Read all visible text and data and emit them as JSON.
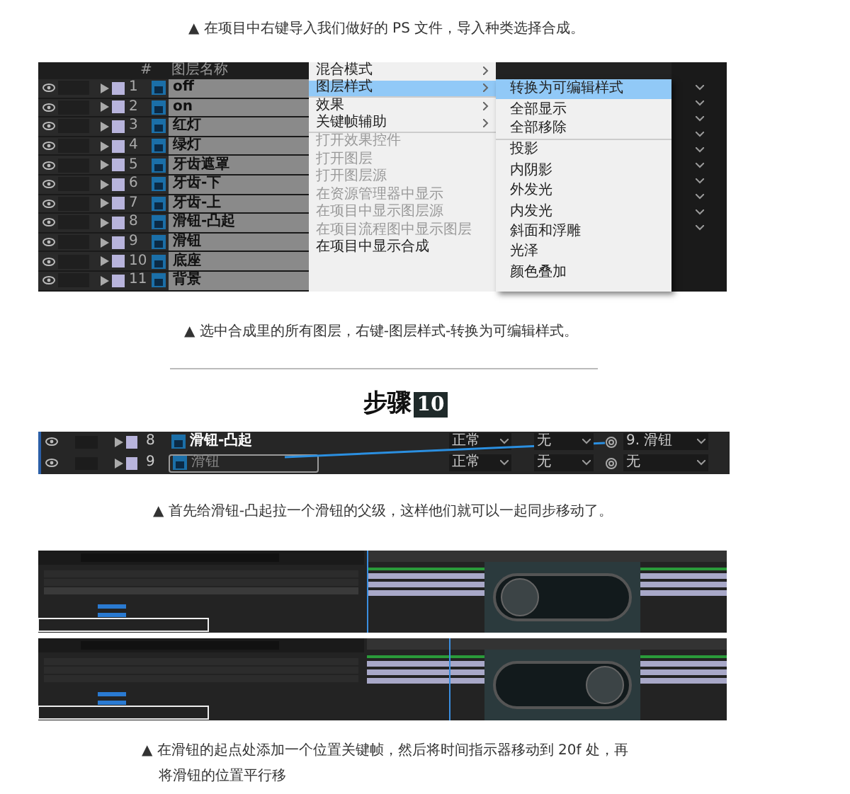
{
  "caption_1": "▲ 在项目中右键导入我们做好的 PS 文件，导入种类选择合成。",
  "screenshot_1": {
    "header": {
      "number": "#",
      "name": "图层名称"
    },
    "layers": [
      {
        "number": "1",
        "name": "off"
      },
      {
        "number": "2",
        "name": "on"
      },
      {
        "number": "3",
        "name": "红灯"
      },
      {
        "number": "4",
        "name": "绿灯"
      },
      {
        "number": "5",
        "name": "牙齿遮罩"
      },
      {
        "number": "6",
        "name": "牙齿-下"
      },
      {
        "number": "7",
        "name": "牙齿-上"
      },
      {
        "number": "8",
        "name": "滑钮-凸起"
      },
      {
        "number": "9",
        "name": "滑钮"
      },
      {
        "number": "10",
        "name": "底座"
      },
      {
        "number": "11",
        "name": "背景"
      }
    ],
    "menu": [
      {
        "label": "混合模式",
        "submenu": true,
        "disabled": false,
        "selected": false,
        "separator_after": false
      },
      {
        "label": "图层样式",
        "submenu": true,
        "disabled": false,
        "selected": true,
        "separator_after": true
      },
      {
        "label": "效果",
        "submenu": true,
        "disabled": false,
        "selected": false,
        "separator_after": false
      },
      {
        "label": "关键帧辅助",
        "submenu": true,
        "disabled": false,
        "selected": false,
        "separator_after": true
      },
      {
        "label": "打开效果控件",
        "submenu": false,
        "disabled": true,
        "selected": false,
        "separator_after": false
      },
      {
        "label": "打开图层",
        "submenu": false,
        "disabled": true,
        "selected": false,
        "separator_after": false
      },
      {
        "label": "打开图层源",
        "submenu": false,
        "disabled": true,
        "selected": false,
        "separator_after": false
      },
      {
        "label": "在资源管理器中显示",
        "submenu": false,
        "disabled": true,
        "selected": false,
        "separator_after": false
      },
      {
        "label": "在项目中显示图层源",
        "submenu": false,
        "disabled": true,
        "selected": false,
        "separator_after": false
      },
      {
        "label": "在项目流程图中显示图层",
        "submenu": false,
        "disabled": true,
        "selected": false,
        "separator_after": false
      },
      {
        "label": "在项目中显示合成",
        "submenu": false,
        "disabled": false,
        "selected": false,
        "separator_after": false
      }
    ],
    "submenu": [
      {
        "label": "转换为可编辑样式",
        "selected": true,
        "separator_after": false
      },
      {
        "label": "全部显示",
        "selected": false,
        "separator_after": false
      },
      {
        "label": "全部移除",
        "selected": false,
        "separator_after": true
      },
      {
        "label": "投影",
        "selected": false,
        "separator_after": false
      },
      {
        "label": "内阴影",
        "selected": false,
        "separator_after": false
      },
      {
        "label": "外发光",
        "selected": false,
        "separator_after": false
      },
      {
        "label": "内发光",
        "selected": false,
        "separator_after": false
      },
      {
        "label": "斜面和浮雕",
        "selected": false,
        "separator_after": false
      },
      {
        "label": "光泽",
        "selected": false,
        "separator_after": false
      },
      {
        "label": "颜色叠加",
        "selected": false,
        "separator_after": false
      }
    ]
  },
  "caption_2": "▲ 选中合成里的所有图层，右键-图层样式-转换为可编辑样式。",
  "step_heading": {
    "label": "步骤",
    "number": "10"
  },
  "screenshot_2": {
    "rows": [
      {
        "number": "8",
        "name": "滑钮-凸起",
        "mode": "正常",
        "track_matte": "无",
        "parent": "9. 滑钮",
        "selected": false
      },
      {
        "number": "9",
        "name": "滑钮",
        "mode": "正常",
        "track_matte": "无",
        "parent": "无",
        "selected": true
      }
    ]
  },
  "caption_3": "▲ 首先给滑钮-凸起拉一个滑钮的父级，这样他们就可以一起同步移动了。",
  "caption_4": [
    "▲ 在滑钮的起点处添加一个位置关键帧，然后将时间指示器移动到 20f 处，再",
    "将滑钮的位置平行移"
  ]
}
